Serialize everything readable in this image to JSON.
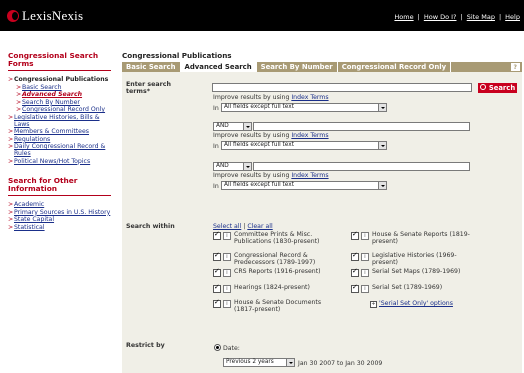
{
  "header": {
    "logo_text": "LexisNexis",
    "links": [
      "Home",
      "How Do I?",
      "Site Map",
      "Help"
    ]
  },
  "sidebar": {
    "title": "Congressional Search Forms",
    "items": [
      {
        "label": "Congressional Publications"
      },
      {
        "label": "Basic Search"
      },
      {
        "label": "Advanced Search"
      },
      {
        "label": "Search By Number"
      },
      {
        "label": "Congressional Record Only"
      },
      {
        "label": "Legislative Histories, Bills & Laws"
      },
      {
        "label": "Members & Committees"
      },
      {
        "label": "Regulations"
      },
      {
        "label": "Daily Congressional Record & Rules"
      },
      {
        "label": "Political News/Hot Topics"
      }
    ],
    "other_title": "Search for Other Information",
    "other_items": [
      {
        "label": "Academic"
      },
      {
        "label": "Primary Sources in U.S. History"
      },
      {
        "label": "State Capital"
      },
      {
        "label": "Statistical"
      }
    ]
  },
  "main": {
    "title": "Congressional Publications",
    "tabs": [
      "Basic Search",
      "Advanced Search",
      "Search By Number",
      "Congressional Record Only"
    ],
    "help_tab": "?",
    "enter_terms_label": "Enter search terms*",
    "search_button": "Search",
    "improve_text": "Improve results by using",
    "index_terms_link": "Index Terms",
    "in_label": "In",
    "field_select": "All fields except full text",
    "connector": "AND",
    "search_within_label": "Search within",
    "select_all": "Select all",
    "clear_all": "Clear all",
    "sep": "|",
    "collections_left": [
      {
        "label": "Committee Prints & Misc. Publications (1830-present)"
      },
      {
        "label": "Congressional Record & Predecessors (1789-1997)"
      },
      {
        "label": "CRS Reports (1916-present)"
      },
      {
        "label": "Hearings (1824-present)"
      },
      {
        "label": "House & Senate Documents (1817-present)"
      }
    ],
    "collections_right": [
      {
        "label": "House & Senate Reports (1819-present)"
      },
      {
        "label": "Legislative Histories (1969-present)"
      },
      {
        "label": "Serial Set Maps (1789-1969)"
      },
      {
        "label": "Serial Set (1789-1969)"
      }
    ],
    "serial_set_options": "'Serial Set Only' options",
    "restrict_label": "Restrict by",
    "date_label": "Date:",
    "date_select": "Previous 2 years",
    "date_range": "Jan 30 2007 to Jan 30 2009"
  }
}
